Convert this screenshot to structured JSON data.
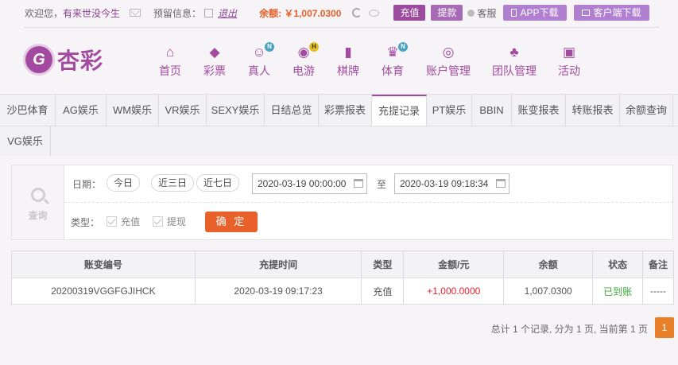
{
  "topbar": {
    "welcome": "欢迎您，",
    "username": "有来世没今生",
    "reserve_label": "预留信息：",
    "logout": "退出",
    "balance": "余额: ￥1,007.0300",
    "recharge": "充值",
    "withdraw": "提款",
    "service": "客服",
    "app_download": "APP下载",
    "client_download": "客户端下载"
  },
  "logo": {
    "badge": "G",
    "name": "杏彩"
  },
  "nav": [
    {
      "label": "首页",
      "icon": "home-icon",
      "tag": ""
    },
    {
      "label": "彩票",
      "icon": "lottery-icon",
      "tag": ""
    },
    {
      "label": "真人",
      "icon": "live-dealer-icon",
      "tag": "N"
    },
    {
      "label": "电游",
      "icon": "gamepad-icon",
      "tag": "H"
    },
    {
      "label": "棋牌",
      "icon": "cards-icon",
      "tag": ""
    },
    {
      "label": "体育",
      "icon": "trophy-icon",
      "tag": "N"
    },
    {
      "label": "账户管理",
      "icon": "account-icon",
      "tag": ""
    },
    {
      "label": "团队管理",
      "icon": "team-icon",
      "tag": ""
    },
    {
      "label": "活动",
      "icon": "gift-icon",
      "tag": ""
    }
  ],
  "tabs": [
    "沙巴体育",
    "AG娱乐",
    "WM娱乐",
    "VR娱乐",
    "SEXY娱乐",
    "日结总览",
    "彩票报表",
    "充提记录",
    "PT娱乐",
    "BBIN",
    "账变报表",
    "转账报表",
    "余额查询",
    "VG娱乐"
  ],
  "active_tab": "充提记录",
  "filter": {
    "query_label": "查询",
    "date_label": "日期：",
    "quick": [
      "今日",
      "近三日",
      "近七日"
    ],
    "start_date": "2020-03-19 00:00:00",
    "to": "至",
    "end_date": "2020-03-19 09:18:34",
    "type_label": "类型：",
    "type_recharge": "充值",
    "type_withdraw": "提现",
    "confirm": "确 定"
  },
  "table": {
    "headers": [
      "账变编号",
      "充提时间",
      "类型",
      "金额/元",
      "余额",
      "状态",
      "备注"
    ],
    "rows": [
      [
        "20200319VGGFGJIHCK",
        "2020-03-19 09:17:23",
        "充值",
        "+1,000.0000",
        "1,007.0300",
        "已到账",
        "-----"
      ]
    ]
  },
  "pager": {
    "summary": "总计 1 个记录, 分为 1 页, 当前第 1 页",
    "current": "1"
  },
  "colors": {
    "brand": "#a24aa0",
    "accent": "#e8602a",
    "success": "#3caa3c",
    "negative": "#e8202a"
  }
}
